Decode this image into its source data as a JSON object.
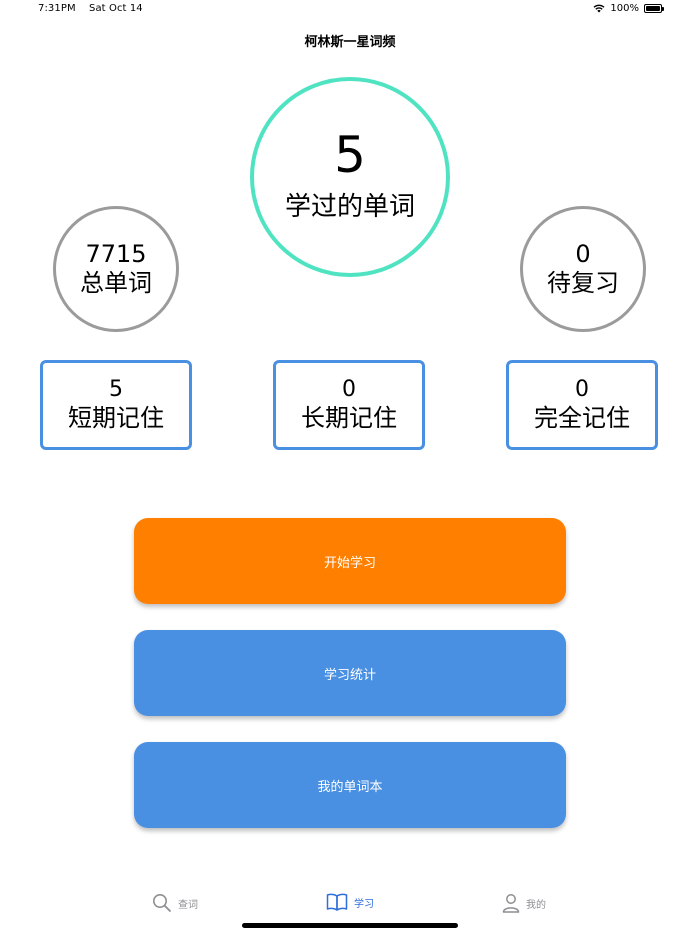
{
  "status_bar": {
    "time": "7:31PM",
    "date": "Sat Oct 14",
    "battery": "100%",
    "wifi_icon": "wifi-icon",
    "battery_icon": "battery-icon"
  },
  "nav": {
    "title": "柯林斯一星词频"
  },
  "stats": {
    "learned": {
      "value": "5",
      "label": "学过的单词"
    },
    "total": {
      "value": "7715",
      "label": "总单词"
    },
    "to_review": {
      "value": "0",
      "label": "待复习"
    },
    "short_term": {
      "value": "5",
      "label": "短期记住"
    },
    "long_term": {
      "value": "0",
      "label": "长期记住"
    },
    "mastered": {
      "value": "0",
      "label": "完全记住"
    }
  },
  "buttons": {
    "start": "开始学习",
    "statistics": "学习统计",
    "wordbook": "我的单词本"
  },
  "tabs": [
    {
      "label": "查词",
      "icon": "search-icon"
    },
    {
      "label": "学习",
      "icon": "book-icon",
      "selected": true
    },
    {
      "label": "我的",
      "icon": "person-icon"
    }
  ],
  "colors": {
    "accent_teal": "#50E3C2",
    "orange": "#FF7F00",
    "blue": "#4A90E2",
    "gray_border": "#9B9B9B",
    "tab_selected": "#2F6FD8"
  }
}
